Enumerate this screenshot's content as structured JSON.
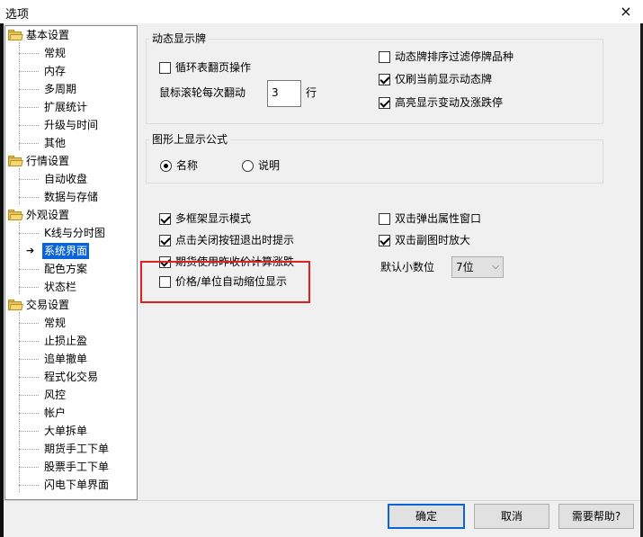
{
  "window": {
    "title": "选项",
    "close_glyph": "×"
  },
  "tree": {
    "groups": [
      {
        "label": "基本设置",
        "children": [
          "常规",
          "内存",
          "多周期",
          "扩展统计",
          "升级与时间",
          "其他"
        ]
      },
      {
        "label": "行情设置",
        "children": [
          "自动收盘",
          "数据与存储"
        ]
      },
      {
        "label": "外观设置",
        "children": [
          "K线与分时图",
          "系统界面",
          "配色方案",
          "状态栏"
        ]
      },
      {
        "label": "交易设置",
        "children": [
          "常规",
          "止损止盈",
          "追单撤单",
          "程式化交易",
          "风控",
          "帐户",
          "大单拆单",
          "期货手工下单",
          "股票手工下单",
          "闪电下单界面"
        ]
      }
    ],
    "selected": "系统界面",
    "selected_arrow": "➔"
  },
  "dynamic_group": {
    "title": "动态显示牌",
    "loop_page": {
      "label": "循环表翻页操作",
      "checked": false
    },
    "scroll_label": "鼠标滚轮每次翻动",
    "scroll_value": "3",
    "scroll_unit": "行",
    "filter_stopped": {
      "label": "动态牌排序过滤停牌品种",
      "checked": false
    },
    "refresh_current": {
      "label": "仅刷当前显示动态牌",
      "checked": true
    },
    "highlight": {
      "label": "高亮显示变动及涨跌停",
      "checked": true
    }
  },
  "formula_group": {
    "title": "图形上显示公式",
    "options": [
      {
        "label": "名称",
        "selected": true
      },
      {
        "label": "说明",
        "selected": false
      }
    ]
  },
  "options": {
    "multi_frame": {
      "label": "多框架显示模式",
      "checked": true
    },
    "close_prompt": {
      "label": "点击关闭按钮退出时提示",
      "checked": true
    },
    "futures_settle": {
      "label": "期货使用昨收价计算涨跌",
      "checked": true
    },
    "price_unit": {
      "label": "价格/单位自动缩位显示",
      "checked": false
    },
    "dbl_prop": {
      "label": "双击弹出属性窗口",
      "checked": false
    },
    "dbl_zoom": {
      "label": "双击副图时放大",
      "checked": true
    },
    "decimals_label": "默认小数位",
    "decimals_value": "7位"
  },
  "buttons": {
    "ok": "确定",
    "cancel": "取消",
    "help": "需要帮助?"
  },
  "colors": {
    "selection": "#0a64d8",
    "highlight_box": "#e02020"
  }
}
